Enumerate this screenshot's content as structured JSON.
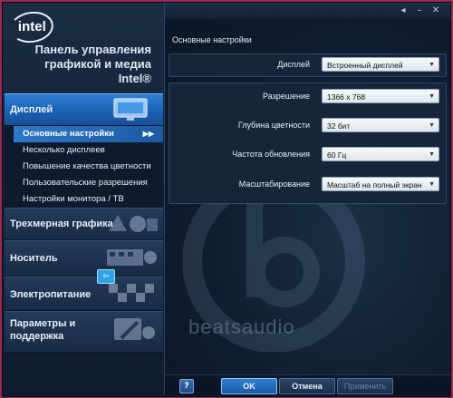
{
  "brand": {
    "logo_text": "intel",
    "app_title": "Панель управления\nграфикой и медиа\nIntel®"
  },
  "window": {
    "restore_icon": "◂",
    "minimize_icon": "–",
    "close_icon": "✕"
  },
  "sidebar": {
    "display_category": "Дисплей",
    "sub_items": [
      {
        "label": "Основные настройки",
        "active": true,
        "arrow": "▶▶"
      },
      {
        "label": "Несколько дисплеев"
      },
      {
        "label": "Повышение качества цветности"
      },
      {
        "label": "Пользовательские разрешения"
      },
      {
        "label": "Настройки монитора / ТВ"
      }
    ],
    "categories": [
      {
        "label": "Трехмерная графика"
      },
      {
        "label": "Носитель"
      },
      {
        "label": "Электропитание"
      },
      {
        "label": "Параметры и\nподдержка"
      }
    ],
    "cursor_glyph": "⇦"
  },
  "main": {
    "section_title": "Основные настройки",
    "display_label": "Дисплей",
    "display_value": "Встроенный дисплей",
    "resolution_label": "Разрешение",
    "resolution_value": "1366 x 768",
    "color_depth_label": "Глубина цветности",
    "color_depth_value": "32 бит",
    "refresh_label": "Частота обновления",
    "refresh_value": "60 Гц",
    "scaling_label": "Масштабирование",
    "scaling_value": "Масштаб на полный экран",
    "dropdown_arrow": "▼",
    "watermark_text": "beatsaudio"
  },
  "footer": {
    "help_label": "?",
    "ok_label": "OK",
    "cancel_label": "Отмена",
    "apply_label": "Применить"
  },
  "colors": {
    "accent": "#2e7fd6",
    "window_bg": "#0c1a2c",
    "outer_bg": "#9a2a4e"
  }
}
